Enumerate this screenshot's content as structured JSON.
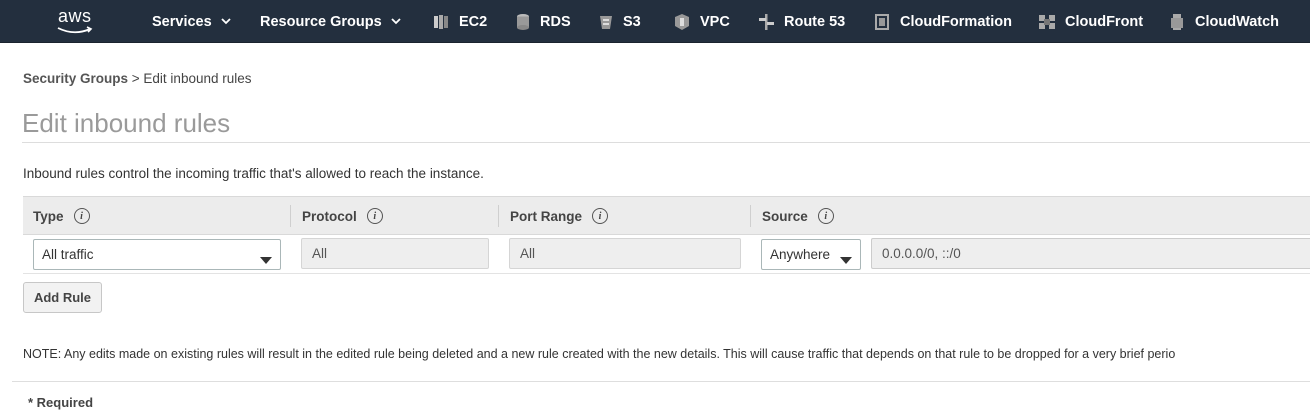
{
  "nav": {
    "logo": "aws",
    "services": "Services",
    "resource_groups": "Resource Groups",
    "shortcuts": [
      {
        "label": "EC2",
        "icon": "ec2-icon"
      },
      {
        "label": "RDS",
        "icon": "rds-icon"
      },
      {
        "label": "S3",
        "icon": "s3-icon"
      },
      {
        "label": "VPC",
        "icon": "vpc-icon"
      },
      {
        "label": "Route 53",
        "icon": "route53-icon"
      },
      {
        "label": "CloudFormation",
        "icon": "cloudformation-icon"
      },
      {
        "label": "CloudFront",
        "icon": "cloudfront-icon"
      },
      {
        "label": "CloudWatch",
        "icon": "cloudwatch-icon"
      }
    ],
    "bg_color": "#232f3e",
    "logo_accent": "#ff9900"
  },
  "breadcrumb": {
    "link": "Security Groups",
    "separator": " > ",
    "current": "Edit inbound rules"
  },
  "page": {
    "title": "Edit inbound rules",
    "description": "Inbound rules control the incoming traffic that's allowed to reach the instance."
  },
  "table": {
    "columns": [
      "Type",
      "Protocol",
      "Port Range",
      "Source"
    ],
    "rows": [
      {
        "type": "All traffic",
        "protocol": "All",
        "port_range": "All",
        "source": "Anywhere",
        "cidr": "0.0.0.0/0, ::/0"
      }
    ]
  },
  "actions": {
    "add_rule": "Add Rule"
  },
  "note": "NOTE: Any edits made on existing rules will result in the edited rule being deleted and a new rule created with the new details. This will cause traffic that depends on that rule to be dropped for a very brief perio",
  "required": "* Required"
}
